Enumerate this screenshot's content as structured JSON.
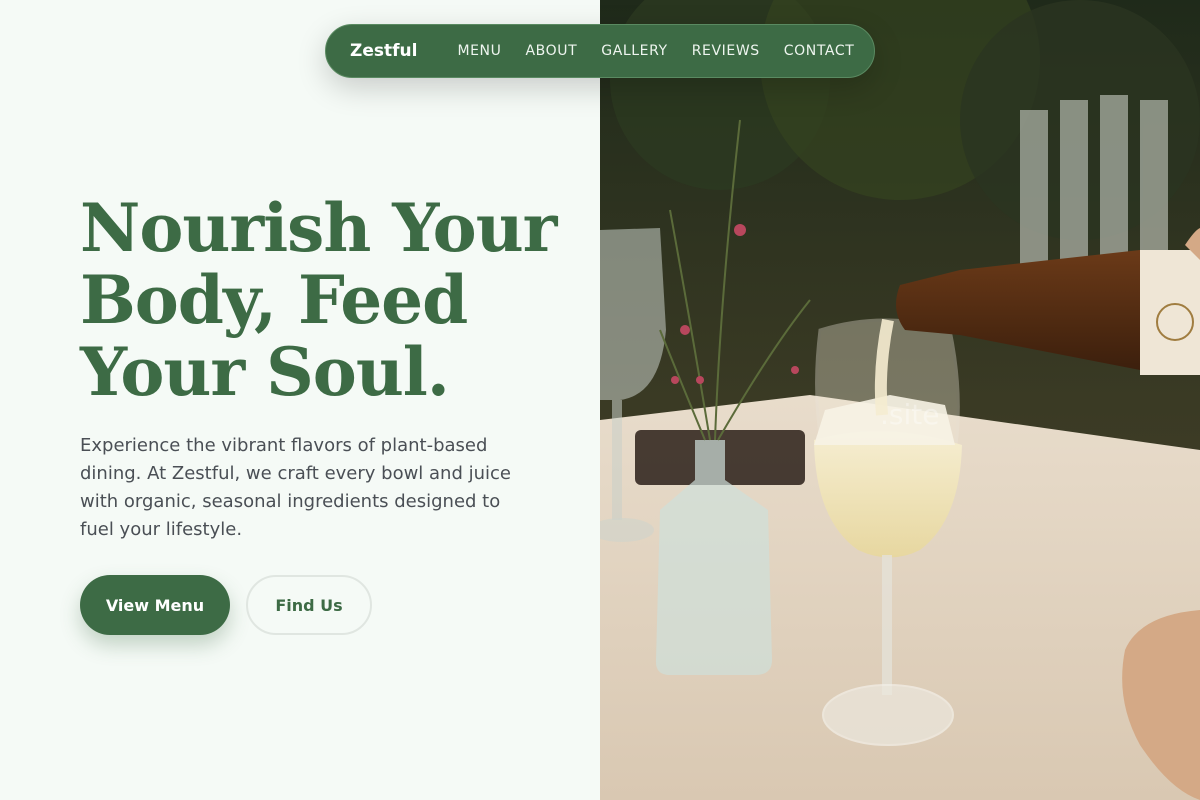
{
  "nav": {
    "brand": "Zestful",
    "links": [
      "MENU",
      "ABOUT",
      "GALLERY",
      "REVIEWS",
      "CONTACT"
    ]
  },
  "hero": {
    "headline_lines": [
      "Nourish Your",
      "Body, Feed",
      "Your Soul."
    ],
    "subtext": "Experience the vibrant flavors of plant-based dining. At Zestful, we craft every bowl and juice with organic, seasonal ingredients designed to fuel your lifestyle.",
    "primary_button": "View Menu",
    "secondary_button": "Find Us"
  },
  "image": {
    "watermark": ".site"
  },
  "colors": {
    "accent": "#3d6b45",
    "background": "#f5faf6",
    "body_text": "#4a4f55"
  }
}
